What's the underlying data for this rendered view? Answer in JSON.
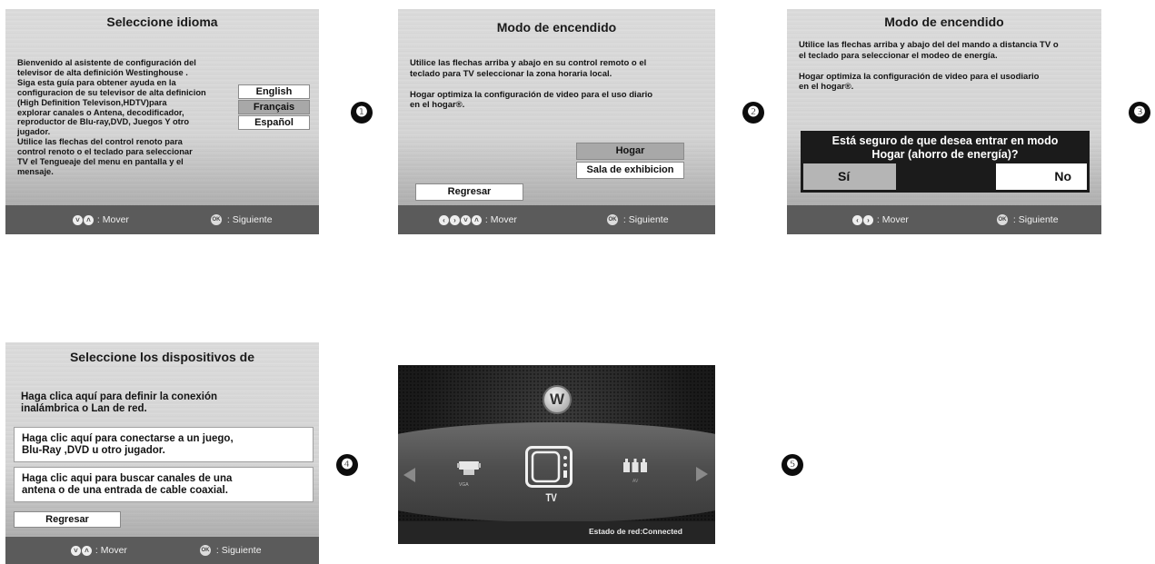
{
  "screen1": {
    "title": "Seleccione idioma",
    "body": "Bienvenido al asistente de configuración del\ntelevisor de alta definición Westinghouse .\nSiga esta guía para obtener ayuda en la\nconfiguracion de su televisor de alta definicion\n(High Definition Televison,HDTV)para\nexplorar canales o Antena, decodificador,\nreproductor de Blu-ray,DVD, Juegos Y otro\njugador.\nUtilice las flechas del control renoto para\ncontrol renoto o el teclado para seleccionar\nTV el Tengueaje del menu en pantalla y el\nmensaje.",
    "options": [
      "English",
      "Français",
      "Español"
    ],
    "footer_move": ": Mover",
    "footer_next": ": Siguiente"
  },
  "screen2": {
    "title": "Modo de encendido",
    "body": "Utilice las flechas arriba y abajo en su control remoto o el\nteclado para TV seleccionar la zona horaria local.\n\nHogar optimiza la configuración de video para el uso diario\nen el hogar®.",
    "options": [
      "Hogar",
      "Sala de exhibicion"
    ],
    "back": "Regresar",
    "footer_move": ": Mover",
    "footer_next": ": Siguiente"
  },
  "screen3": {
    "title": "Modo de encendido",
    "body": "Utilice las flechas arriba y abajo del del mando a distancia TV o\nel teclado para seleccionar el modeo de energía.\n\nHogar optimiza la configuración de video para el usodiario\nen el hogar®.",
    "dialog_text": "Está seguro de que desea entrar en modo\nHogar (ahorro de energía)?",
    "yes": "Sí",
    "no": "No",
    "footer_move": ": Mover",
    "footer_next": ": Siguiente"
  },
  "screen4": {
    "title": "Seleccione los dispositivos de",
    "rows": [
      "Haga clica aquí para definir la conexión\ninalámbrica o Lan de red.",
      "Haga clic aquí para conectarse a un juego,\nBlu-Ray ,DVD u otro jugador.",
      "Haga clic aqui para buscar canales de una\nantena o de una entrada de cable coaxial."
    ],
    "back": "Regresar",
    "footer_move": ": Mover",
    "footer_next": ": Siguiente"
  },
  "screen5": {
    "logo": "W",
    "icon_left_label": "VGA",
    "icon_center_label": "TV",
    "icon_right_label": "AV",
    "status": "Estado de red:Connected"
  },
  "steps": [
    "❶",
    "❷",
    "❸",
    "❹",
    "❺"
  ],
  "ok_glyph": "OK",
  "glyphs": {
    "left": "‹",
    "right": "›",
    "up": "˄",
    "down": "˅"
  }
}
